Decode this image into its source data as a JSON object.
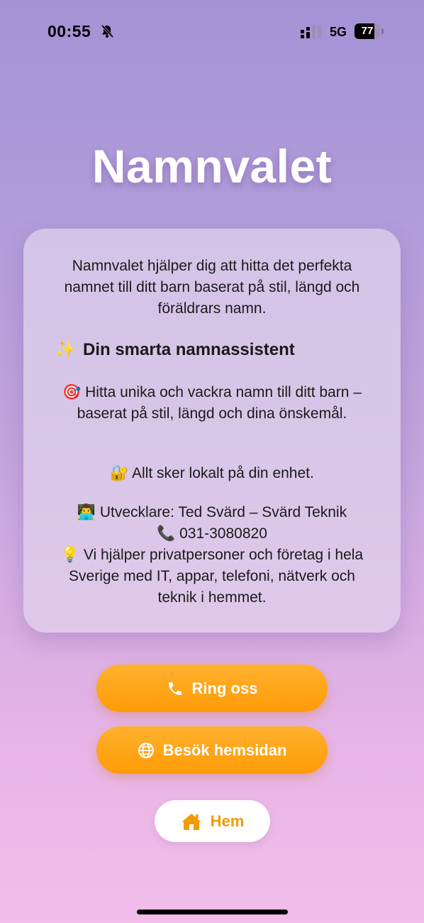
{
  "status_bar": {
    "time": "00:55",
    "network": "5G",
    "battery_percent": "77",
    "battery_level": 0.77
  },
  "app": {
    "title": "Namnvalet"
  },
  "card": {
    "intro": "Namnvalet hjälper dig att hitta det perfekta namnet till ditt barn baserat på stil, längd och föräldrars namn.",
    "heading_icon": "✨",
    "heading": "Din smarta namnassistent",
    "feature_icon": "🎯",
    "feature": "Hitta unika och vackra namn till ditt barn – baserat på stil, längd och dina önskemål.",
    "privacy_icon": "🔐",
    "privacy": "Allt sker lokalt på din enhet.",
    "developer_icon": "👨‍💻",
    "developer": "Utvecklare: Ted Svärd – Svärd Teknik",
    "phone_icon": "📞",
    "phone": "031-3080820",
    "tip_icon": "💡",
    "tip": "Vi hjälper privatpersoner och företag i hela Sverige med IT, appar, telefoni, nätverk och teknik i hemmet."
  },
  "buttons": {
    "call_label": "Ring oss",
    "website_label": "Besök hemsidan",
    "home_label": "Hem"
  },
  "icons": {
    "call": "phone-icon",
    "website": "globe-icon",
    "home": "house-icon",
    "status_mute": "bell-slash-icon"
  },
  "colors": {
    "accent": "#ff9f0a",
    "title": "#ffffff"
  }
}
